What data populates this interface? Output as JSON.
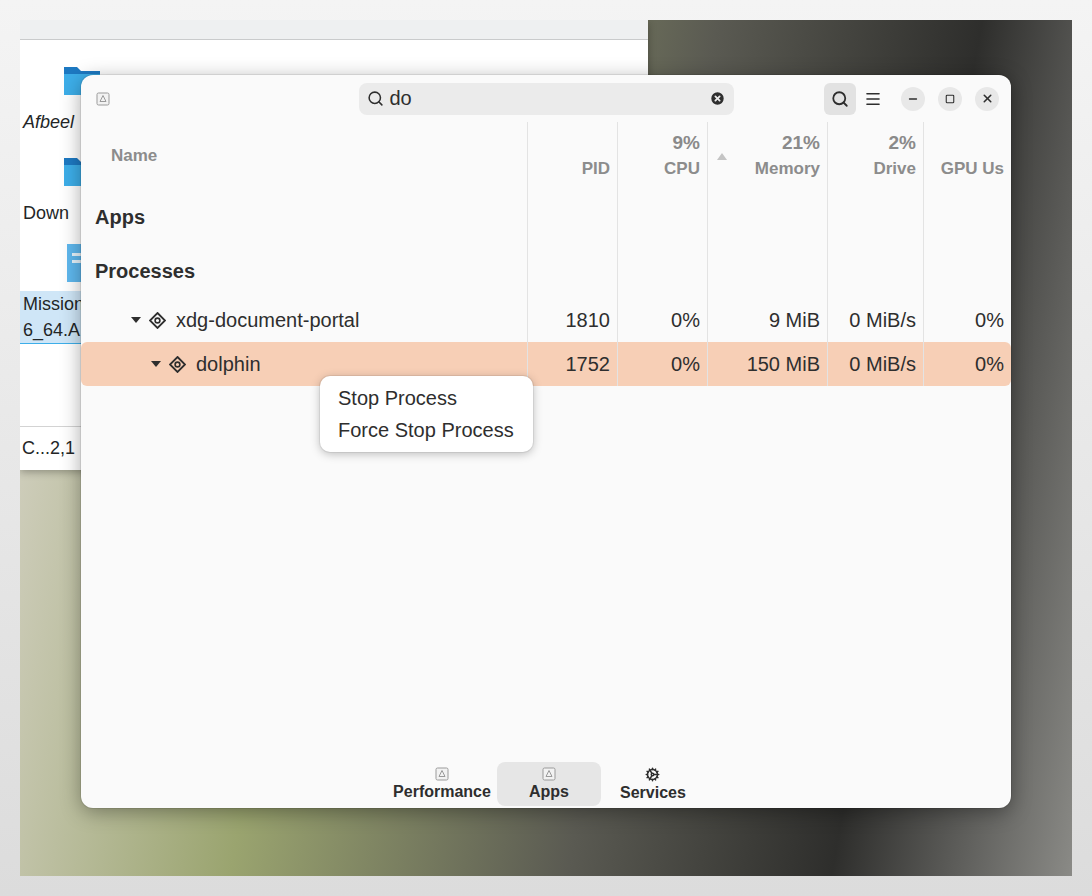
{
  "desktop": {
    "background_window": {
      "items": [
        {
          "label": [
            "Afbeel"
          ],
          "kind": "folder",
          "italic": true,
          "selected": false
        },
        {
          "label": [
            "Down"
          ],
          "kind": "folder",
          "italic": false,
          "selected": false
        },
        {
          "label": [
            "Mission",
            "6_64.A"
          ],
          "kind": "file",
          "italic": false,
          "selected": true
        }
      ],
      "status_bar": "C...2,1"
    }
  },
  "window": {
    "search": {
      "value": "do",
      "active": true
    },
    "table": {
      "columns": [
        {
          "label": "Name",
          "usage": "",
          "sorted": false
        },
        {
          "label": "PID",
          "usage": "",
          "sorted": false
        },
        {
          "label": "CPU",
          "usage": "9%",
          "sorted": false
        },
        {
          "label": "Memory",
          "usage": "21%",
          "sorted": true
        },
        {
          "label": "Drive",
          "usage": "2%",
          "sorted": false
        },
        {
          "label": "GPU Us",
          "usage": "",
          "sorted": false
        }
      ],
      "sections": [
        {
          "title": "Apps",
          "rows": []
        },
        {
          "title": "Processes",
          "rows": [
            {
              "name": "xdg-document-portal",
              "cells": [
                "1810",
                "0%",
                "9 MiB",
                "0 MiB/s",
                "0%"
              ],
              "depth": 0,
              "expanded": true,
              "selected": false
            },
            {
              "name": "dolphin",
              "cells": [
                "1752",
                "0%",
                "150 MiB",
                "0 MiB/s",
                "0%"
              ],
              "depth": 1,
              "expanded": true,
              "selected": true
            }
          ]
        }
      ]
    },
    "context_menu": {
      "items": [
        "Stop Process",
        "Force Stop Process"
      ]
    },
    "tabs": [
      {
        "label": "Performance",
        "selected": false
      },
      {
        "label": "Apps",
        "selected": true
      },
      {
        "label": "Services",
        "selected": false
      }
    ]
  }
}
